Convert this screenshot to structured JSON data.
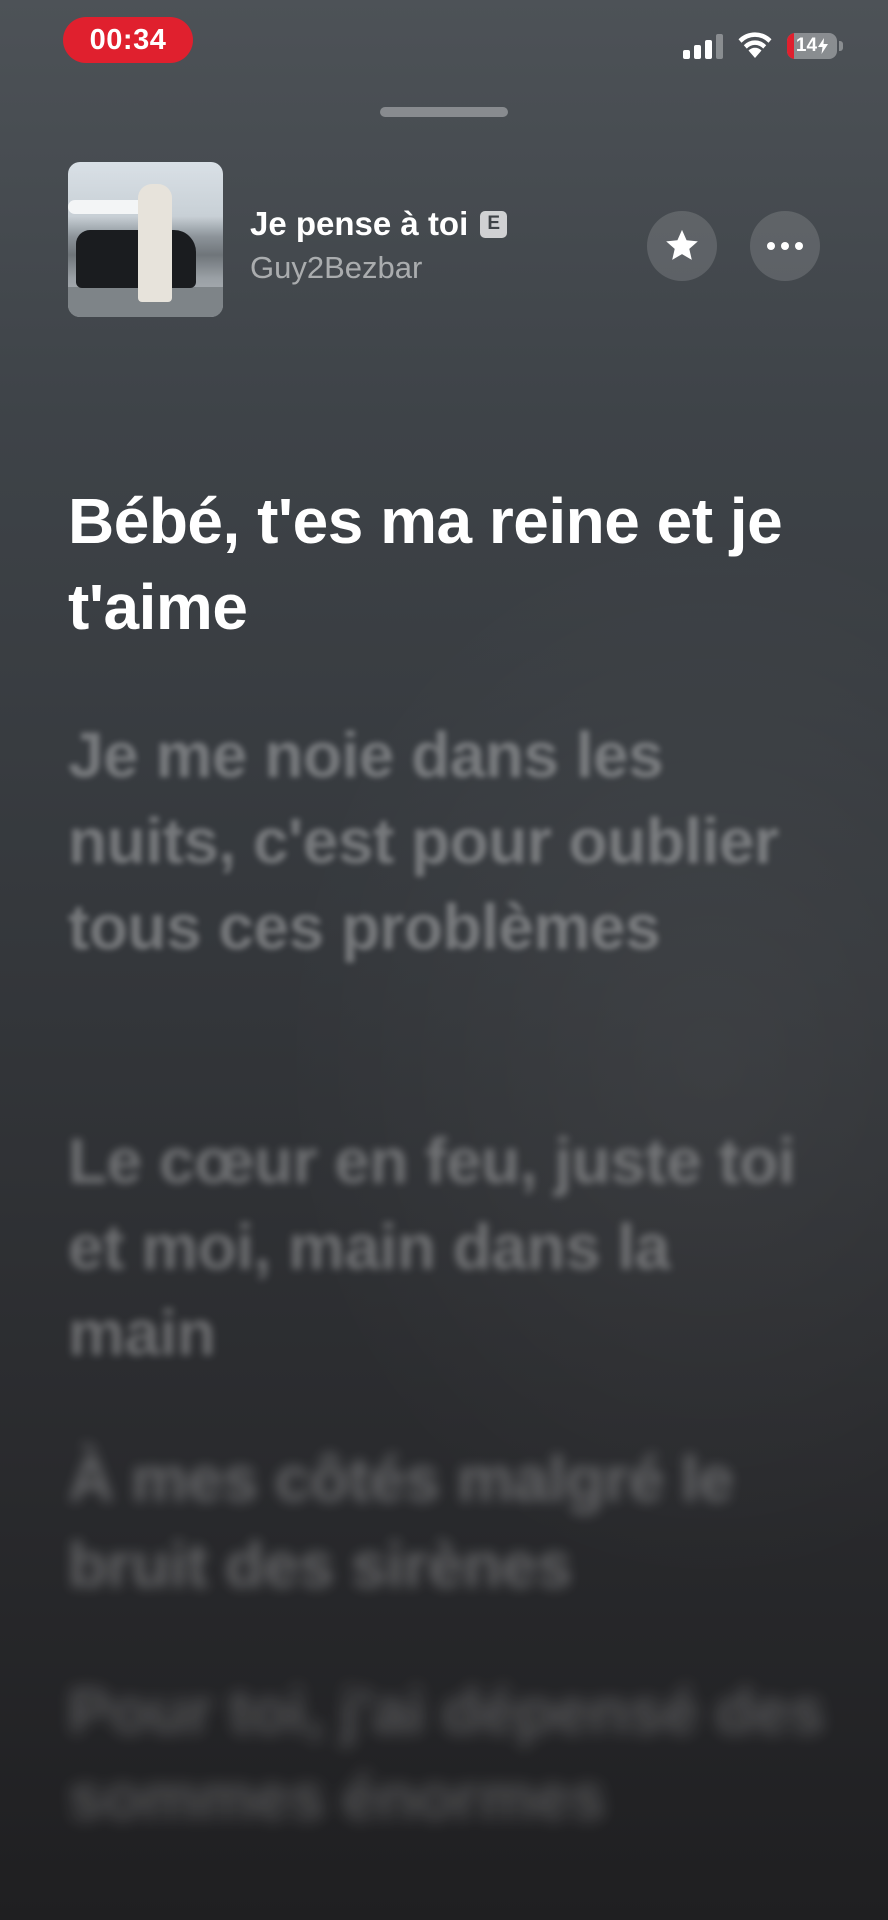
{
  "status_bar": {
    "recording_time": "00:34",
    "battery_level": "14",
    "battery_fraction": 0.14,
    "signal_bars_active": 3,
    "signal_bars_total": 4,
    "icons": [
      "signal-icon",
      "wifi-icon",
      "battery-icon"
    ]
  },
  "now_playing": {
    "title": "Je pense à toi",
    "explicit_label": "E",
    "artist": "Guy2Bezbar",
    "favorite_icon": "star-icon",
    "more_icon": "ellipsis-icon"
  },
  "lyrics": {
    "active": "Bébé, t'es ma reine et je t'aime",
    "upcoming": [
      "Je me noie dans les nuits, c'est pour oublier tous ces problèmes",
      "Le cœur en feu, juste toi et moi, main dans la main",
      "À mes côtés malgré le bruit des sirènes",
      "Pour toi, j'ai dépensé des sommes énormes"
    ]
  },
  "colors": {
    "recording_red": "#e0202e",
    "background_top": "#4d5257",
    "background_bottom": "#1f1f21"
  }
}
